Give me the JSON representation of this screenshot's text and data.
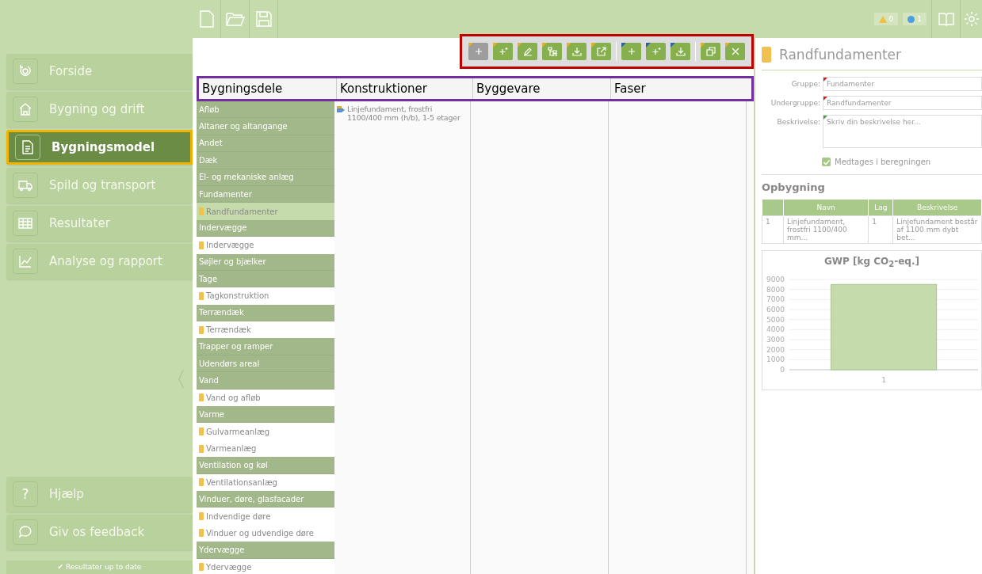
{
  "sidebar": {
    "items": [
      {
        "label": "Forside",
        "selected": false
      },
      {
        "label": "Bygning og drift",
        "selected": false
      },
      {
        "label": "Bygningsmodel",
        "selected": true
      },
      {
        "label": "Spild og transport",
        "selected": false
      },
      {
        "label": "Resultater",
        "selected": false
      },
      {
        "label": "Analyse og rapport",
        "selected": false
      }
    ],
    "collapse": "〈",
    "footer_items": [
      {
        "label": "Hjælp",
        "icon_text": "?"
      },
      {
        "label": "Giv os feedback"
      }
    ],
    "status": "✔ Resultater up to date"
  },
  "topbar": {
    "warnings": "0",
    "infos": "1"
  },
  "toolbar": {
    "groups": [
      [
        {
          "disabled": true,
          "color": "#e0b030"
        },
        {
          "disabled": false,
          "color": "#e0b030"
        },
        {
          "disabled": false,
          "color": "#e0b030"
        },
        {
          "disabled": false,
          "color": "#e0b030"
        },
        {
          "disabled": false,
          "color": "#e0b030"
        },
        {
          "disabled": false,
          "color": "#e0b030"
        }
      ],
      [
        {
          "disabled": false,
          "color": "#3060a0"
        },
        {
          "disabled": false,
          "color": "#3060a0"
        },
        {
          "disabled": false,
          "color": "#3060a0"
        }
      ],
      [
        {
          "disabled": false,
          "color": "#e0b030"
        },
        {
          "disabled": false,
          "color": "#e0b030"
        }
      ]
    ]
  },
  "columns": [
    "Bygningsdele",
    "Konstruktioner",
    "Byggevare",
    "Faser"
  ],
  "tree": [
    {
      "label": "Afløb"
    },
    {
      "label": "Altaner og altangange"
    },
    {
      "label": "Andet"
    },
    {
      "label": "Dæk"
    },
    {
      "label": "El- og mekaniske anlæg"
    },
    {
      "label": "Fundamenter",
      "children": [
        {
          "label": "Randfundamenter",
          "selected": true
        }
      ]
    },
    {
      "label": "Indervægge",
      "children": [
        {
          "label": "Indervægge",
          "selected": false
        }
      ]
    },
    {
      "label": "Søjler og bjælker"
    },
    {
      "label": "Tage",
      "children": [
        {
          "label": "Tagkonstruktion",
          "selected": false
        }
      ]
    },
    {
      "label": "Terrændæk",
      "children": [
        {
          "label": "Terrændæk",
          "selected": false
        }
      ]
    },
    {
      "label": "Trapper og ramper"
    },
    {
      "label": "Udendørs areal"
    },
    {
      "label": "Vand",
      "children": [
        {
          "label": "Vand og afløb",
          "selected": false
        }
      ]
    },
    {
      "label": "Varme",
      "children": [
        {
          "label": "Gulvarmeanlæg",
          "selected": false
        },
        {
          "label": "Varmeanlæg",
          "selected": false
        }
      ]
    },
    {
      "label": "Ventilation og køl",
      "children": [
        {
          "label": "Ventilationsanlæg",
          "selected": false
        }
      ]
    },
    {
      "label": "Vinduer, døre, glasfacader",
      "children": [
        {
          "label": "Indvendige døre",
          "selected": false
        },
        {
          "label": "Vinduer og udvendige døre",
          "selected": false
        }
      ]
    },
    {
      "label": "Ydervægge",
      "children": [
        {
          "label": "Ydervægge",
          "selected": false
        }
      ]
    }
  ],
  "constructions": [
    "Linjefundament, frostfri 1100/400 mm (h/b), 1-5 etager"
  ],
  "detail": {
    "title": "Randfundamenter",
    "fields": [
      {
        "label": "Gruppe:",
        "value": "Fundamenter",
        "required": true,
        "kind": "input"
      },
      {
        "label": "Undergruppe:",
        "value": "Randfundamenter",
        "required": true,
        "kind": "input"
      },
      {
        "label": "Beskrivelse:",
        "placeholder": "Skriv din beskrivelse her...",
        "required": false,
        "kind": "textarea"
      }
    ],
    "include": {
      "label": "Medtages i beregningen",
      "checked": true
    },
    "section": "Opbygning",
    "table": {
      "columns": [
        "",
        "Navn",
        "Lag",
        "Beskrivelse"
      ],
      "rows": [
        [
          "1",
          "Linjefundament, frostfri 1100/400 mm...",
          "1",
          "Linjefundament består af 1100 mm dybt bet..."
        ]
      ]
    },
    "chart_data": {
      "type": "bar",
      "title": "GWP [kg CO$_{2}$-eq.]",
      "categories": [
        "1"
      ],
      "series": [
        {
          "color": "#c5dbab",
          "values": [
            8500
          ]
        }
      ],
      "grid": true,
      "ylim": [
        0,
        9000
      ],
      "yticks": [
        0,
        1000,
        2000,
        3000,
        4000,
        5000,
        6000,
        7000,
        8000,
        9000
      ]
    }
  }
}
